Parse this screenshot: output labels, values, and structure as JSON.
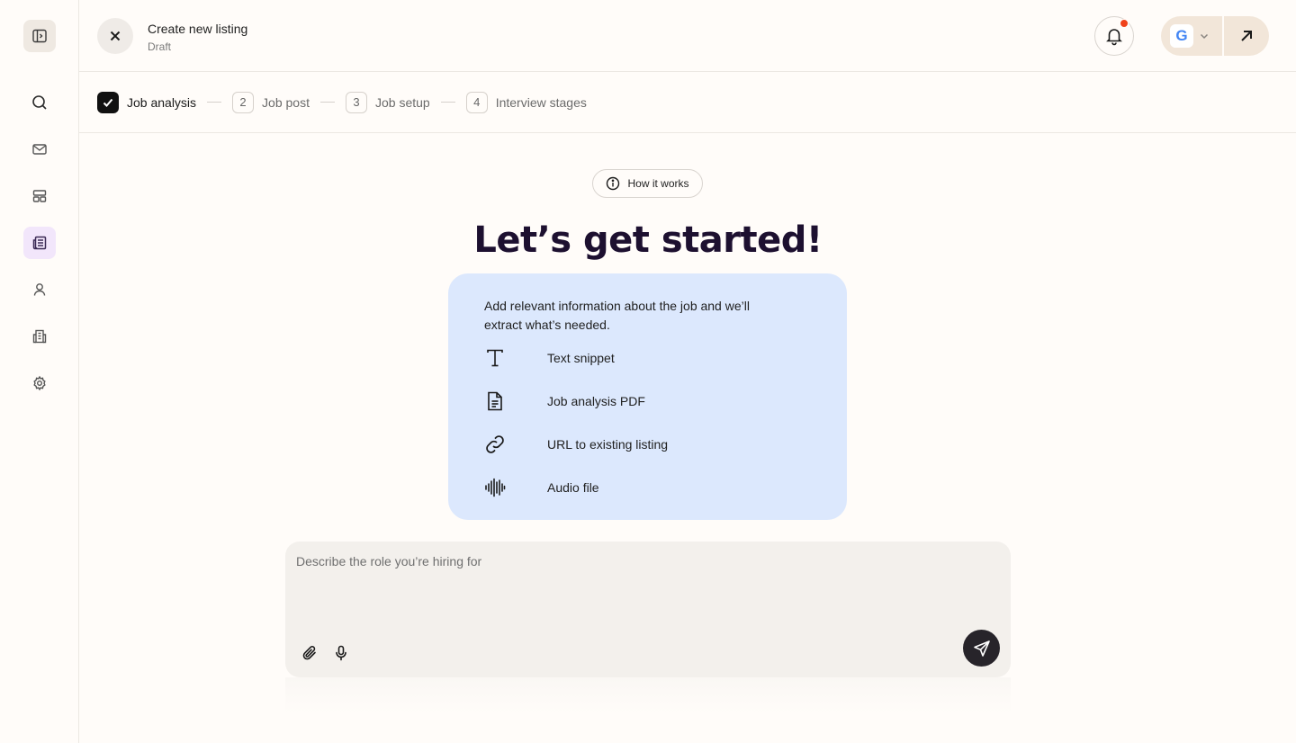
{
  "header": {
    "title": "Create new listing",
    "subtitle": "Draft",
    "account_letter": "G"
  },
  "sidebar": {
    "items": [
      {
        "name": "search"
      },
      {
        "name": "mail"
      },
      {
        "name": "layout"
      },
      {
        "name": "listings",
        "active": true
      },
      {
        "name": "user"
      },
      {
        "name": "building"
      },
      {
        "name": "settings"
      }
    ]
  },
  "stepper": {
    "steps": [
      {
        "number": "1",
        "label": "Job analysis",
        "done": true
      },
      {
        "number": "2",
        "label": "Job post",
        "done": false
      },
      {
        "number": "3",
        "label": "Job setup",
        "done": false
      },
      {
        "number": "4",
        "label": "Interview stages",
        "done": false
      }
    ]
  },
  "main": {
    "how_it_works_label": "How it works",
    "heading": "Let’s get started!",
    "info_intro": "Add relevant information about the job and we’ll extract what’s needed.",
    "options": [
      {
        "label": "Text snippet",
        "icon": "text-icon"
      },
      {
        "label": "Job analysis PDF",
        "icon": "document-icon"
      },
      {
        "label": "URL to existing listing",
        "icon": "link-icon"
      },
      {
        "label": "Audio file",
        "icon": "audio-wave-icon"
      }
    ],
    "composer_placeholder": "Describe the role you’re hiring for"
  },
  "colors": {
    "card_bg": "#dce8fd",
    "active_nav_bg": "#f2e6fb",
    "notification_dot": "#f0421a",
    "account_bg": "#f2e6d9",
    "send_bg": "#27242a"
  }
}
